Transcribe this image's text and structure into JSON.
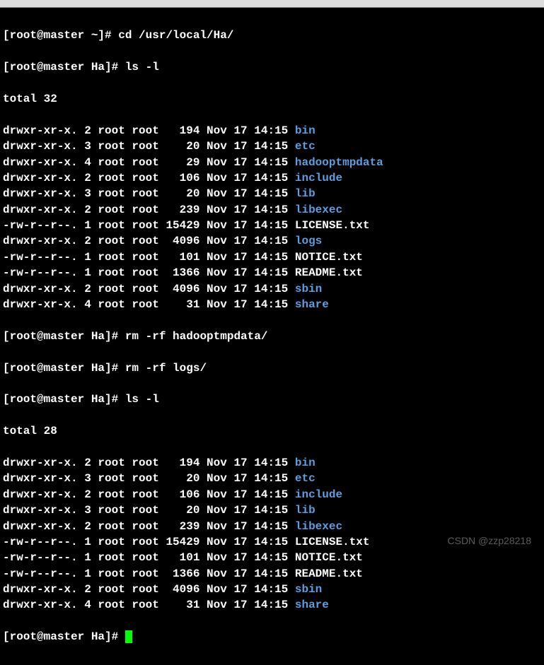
{
  "prompts": {
    "cd": "[root@master ~]# cd /usr/local/Ha/",
    "ls1": "[root@master Ha]# ls -l",
    "rm1": "[root@master Ha]# rm -rf hadooptmpdata/",
    "rm2": "[root@master Ha]# rm -rf logs/",
    "ls2": "[root@master Ha]# ls -l",
    "end": "[root@master Ha]# "
  },
  "totals": {
    "first": "total 32",
    "second": "total 28"
  },
  "listing1": [
    {
      "perm": "drwxr-xr-x.",
      "links": "2",
      "owner": "root",
      "group": "root",
      "size": "194",
      "date": "Nov 17 14:15",
      "name": "bin",
      "type": "dir"
    },
    {
      "perm": "drwxr-xr-x.",
      "links": "3",
      "owner": "root",
      "group": "root",
      "size": "20",
      "date": "Nov 17 14:15",
      "name": "etc",
      "type": "dir"
    },
    {
      "perm": "drwxr-xr-x.",
      "links": "4",
      "owner": "root",
      "group": "root",
      "size": "29",
      "date": "Nov 17 14:15",
      "name": "hadooptmpdata",
      "type": "dir"
    },
    {
      "perm": "drwxr-xr-x.",
      "links": "2",
      "owner": "root",
      "group": "root",
      "size": "106",
      "date": "Nov 17 14:15",
      "name": "include",
      "type": "dir"
    },
    {
      "perm": "drwxr-xr-x.",
      "links": "3",
      "owner": "root",
      "group": "root",
      "size": "20",
      "date": "Nov 17 14:15",
      "name": "lib",
      "type": "dir"
    },
    {
      "perm": "drwxr-xr-x.",
      "links": "2",
      "owner": "root",
      "group": "root",
      "size": "239",
      "date": "Nov 17 14:15",
      "name": "libexec",
      "type": "dir"
    },
    {
      "perm": "-rw-r--r--.",
      "links": "1",
      "owner": "root",
      "group": "root",
      "size": "15429",
      "date": "Nov 17 14:15",
      "name": "LICENSE.txt",
      "type": "file"
    },
    {
      "perm": "drwxr-xr-x.",
      "links": "2",
      "owner": "root",
      "group": "root",
      "size": "4096",
      "date": "Nov 17 14:15",
      "name": "logs",
      "type": "dir"
    },
    {
      "perm": "-rw-r--r--.",
      "links": "1",
      "owner": "root",
      "group": "root",
      "size": "101",
      "date": "Nov 17 14:15",
      "name": "NOTICE.txt",
      "type": "file"
    },
    {
      "perm": "-rw-r--r--.",
      "links": "1",
      "owner": "root",
      "group": "root",
      "size": "1366",
      "date": "Nov 17 14:15",
      "name": "README.txt",
      "type": "file"
    },
    {
      "perm": "drwxr-xr-x.",
      "links": "2",
      "owner": "root",
      "group": "root",
      "size": "4096",
      "date": "Nov 17 14:15",
      "name": "sbin",
      "type": "dir"
    },
    {
      "perm": "drwxr-xr-x.",
      "links": "4",
      "owner": "root",
      "group": "root",
      "size": "31",
      "date": "Nov 17 14:15",
      "name": "share",
      "type": "dir"
    }
  ],
  "listing2": [
    {
      "perm": "drwxr-xr-x.",
      "links": "2",
      "owner": "root",
      "group": "root",
      "size": "194",
      "date": "Nov 17 14:15",
      "name": "bin",
      "type": "dir"
    },
    {
      "perm": "drwxr-xr-x.",
      "links": "3",
      "owner": "root",
      "group": "root",
      "size": "20",
      "date": "Nov 17 14:15",
      "name": "etc",
      "type": "dir"
    },
    {
      "perm": "drwxr-xr-x.",
      "links": "2",
      "owner": "root",
      "group": "root",
      "size": "106",
      "date": "Nov 17 14:15",
      "name": "include",
      "type": "dir"
    },
    {
      "perm": "drwxr-xr-x.",
      "links": "3",
      "owner": "root",
      "group": "root",
      "size": "20",
      "date": "Nov 17 14:15",
      "name": "lib",
      "type": "dir"
    },
    {
      "perm": "drwxr-xr-x.",
      "links": "2",
      "owner": "root",
      "group": "root",
      "size": "239",
      "date": "Nov 17 14:15",
      "name": "libexec",
      "type": "dir"
    },
    {
      "perm": "-rw-r--r--.",
      "links": "1",
      "owner": "root",
      "group": "root",
      "size": "15429",
      "date": "Nov 17 14:15",
      "name": "LICENSE.txt",
      "type": "file"
    },
    {
      "perm": "-rw-r--r--.",
      "links": "1",
      "owner": "root",
      "group": "root",
      "size": "101",
      "date": "Nov 17 14:15",
      "name": "NOTICE.txt",
      "type": "file"
    },
    {
      "perm": "-rw-r--r--.",
      "links": "1",
      "owner": "root",
      "group": "root",
      "size": "1366",
      "date": "Nov 17 14:15",
      "name": "README.txt",
      "type": "file"
    },
    {
      "perm": "drwxr-xr-x.",
      "links": "2",
      "owner": "root",
      "group": "root",
      "size": "4096",
      "date": "Nov 17 14:15",
      "name": "sbin",
      "type": "dir"
    },
    {
      "perm": "drwxr-xr-x.",
      "links": "4",
      "owner": "root",
      "group": "root",
      "size": "31",
      "date": "Nov 17 14:15",
      "name": "share",
      "type": "dir"
    }
  ],
  "watermark": "CSDN @zzp28218"
}
